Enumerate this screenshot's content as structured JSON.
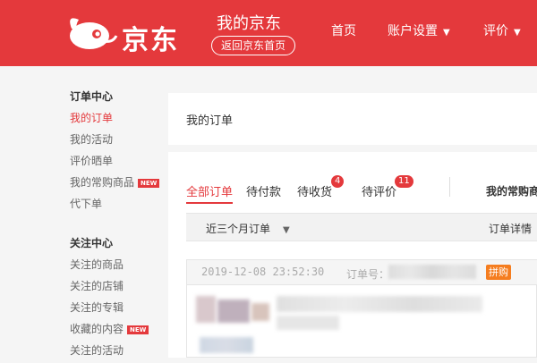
{
  "header": {
    "brand": "京东",
    "my_jd": "我的京东",
    "back_home": "返回京东首页",
    "nav": [
      {
        "label": "首页",
        "has_arrow": false
      },
      {
        "label": "账户设置",
        "has_arrow": true
      },
      {
        "label": "评价",
        "has_arrow": true
      }
    ],
    "accent_color": "#e4393c"
  },
  "sidebar": {
    "groups": [
      {
        "title": "订单中心",
        "items": [
          {
            "label": "我的订单",
            "active": true,
            "badge": ""
          },
          {
            "label": "我的活动",
            "active": false,
            "badge": ""
          },
          {
            "label": "评价晒单",
            "active": false,
            "badge": ""
          },
          {
            "label": "我的常购商品",
            "active": false,
            "badge": "NEW"
          },
          {
            "label": "代下单",
            "active": false,
            "badge": ""
          }
        ]
      },
      {
        "title": "关注中心",
        "items": [
          {
            "label": "关注的商品",
            "active": false,
            "badge": ""
          },
          {
            "label": "关注的店铺",
            "active": false,
            "badge": ""
          },
          {
            "label": "关注的专辑",
            "active": false,
            "badge": ""
          },
          {
            "label": "收藏的内容",
            "active": false,
            "badge": "NEW"
          },
          {
            "label": "关注的活动",
            "active": false,
            "badge": ""
          }
        ]
      }
    ]
  },
  "main": {
    "page_title": "我的订单",
    "tabs": [
      {
        "label": "全部订单",
        "count": ""
      },
      {
        "label": "待付款",
        "count": ""
      },
      {
        "label": "待收货",
        "count": "4"
      },
      {
        "label": "待评价",
        "count": "11"
      }
    ],
    "frequent_label": "我的常购商",
    "filter": {
      "range": "近三个月订单",
      "detail": "订单详情"
    },
    "order": {
      "time": "2019-12-08 23:52:30",
      "number_label": "订单号：",
      "tag": "拼购",
      "tag_color": "#f57d1f"
    }
  }
}
